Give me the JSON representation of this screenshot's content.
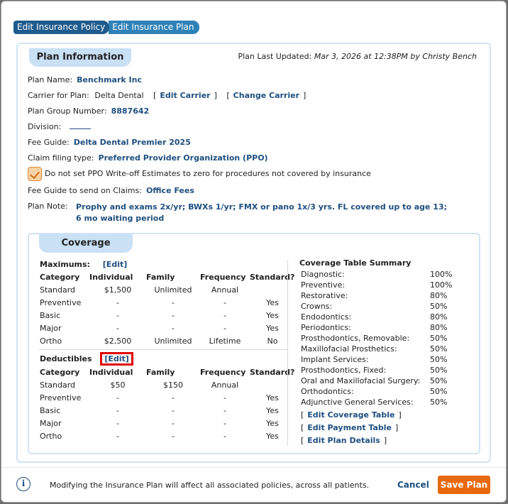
{
  "tabs": [
    "Edit Insurance Policy",
    "Edit Insurance Plan"
  ],
  "plan": {
    "header": "Plan Information",
    "updated_label": "Plan Last Updated:",
    "updated_value": "Mar 3, 2026 at 12:38PM by Christy Bench",
    "name_label": "Plan Name:",
    "name_value": "Benchmark Inc",
    "carrier_label": "Carrier for Plan:",
    "carrier_value": "Delta Dental",
    "edit_carrier": "Edit Carrier",
    "change_carrier": "Change Carrier",
    "group_label": "Plan Group Number:",
    "group_value": "8887642",
    "division_label": "Division:",
    "division_value": "",
    "fee_label": "Fee Guide:",
    "fee_value": "Delta Dental Premier 2025",
    "claim_label": "Claim filing type:",
    "claim_value": "Preferred Provider Organization (PPO)",
    "ppo_checkbox_label": "Do not set PPO Write-off Estimates to zero for procedures not covered by insurance",
    "fee_claims_label": "Fee Guide to send on Claims:",
    "fee_claims_value": "Office Fees",
    "note_label": "Plan Note:",
    "note_line1": "Prophy and exams 2x/yr; BWXs 1/yr; FMX or pano 1x/3 yrs. FL covered up to age 13;",
    "note_line2": "6 mo waiting period"
  },
  "coverage": {
    "header": "Coverage",
    "maximums_label": "Maximums:",
    "deductibles_label": "Deductibles",
    "edit_label": "[Edit]",
    "columns": [
      "Category",
      "Individual",
      "Family",
      "Frequency",
      "Standard?"
    ],
    "maximums": [
      [
        "Standard",
        "$1,500",
        "Unlimited",
        "Annual",
        ""
      ],
      [
        "Preventive",
        "-",
        "-",
        "-",
        "Yes"
      ],
      [
        "Basic",
        "-",
        "-",
        "-",
        "Yes"
      ],
      [
        "Major",
        "-",
        "-",
        "-",
        "Yes"
      ],
      [
        "Ortho",
        "$2,500",
        "Unlimited",
        "Lifetime",
        "No"
      ]
    ],
    "deductibles": [
      [
        "Standard",
        "$50",
        "$150",
        "Annual",
        ""
      ],
      [
        "Preventive",
        "-",
        "-",
        "-",
        "Yes"
      ],
      [
        "Basic",
        "-",
        "-",
        "-",
        "Yes"
      ],
      [
        "Major",
        "-",
        "-",
        "-",
        "Yes"
      ],
      [
        "Ortho",
        "-",
        "-",
        "-",
        "Yes"
      ]
    ],
    "summary_title": "Coverage Table Summary",
    "summary": [
      [
        "Diagnostic:",
        "100%"
      ],
      [
        "Preventive:",
        "100%"
      ],
      [
        "Restorative:",
        "80%"
      ],
      [
        "Crowns:",
        "50%"
      ],
      [
        "Endodontics:",
        "80%"
      ],
      [
        "Periodontics:",
        "80%"
      ],
      [
        "Prosthodontics, Removable:",
        "50%"
      ],
      [
        "Maxillofacial Prosthetics:",
        "50%"
      ],
      [
        "Implant Services:",
        "50%"
      ],
      [
        "Prosthodontics, Fixed:",
        "50%"
      ],
      [
        "Oral and Maxillofacial Surgery:",
        "50%"
      ],
      [
        "Orthodontics:",
        "50%"
      ],
      [
        "Adjunctive General Services:",
        "50%"
      ]
    ],
    "links": [
      "Edit Coverage Table",
      "Edit Payment Table",
      "Edit Plan Details"
    ]
  },
  "footer": {
    "message": "Modifying the Insurance Plan will affect all associated policies, across all patients.",
    "cancel": "Cancel",
    "save": "Save Plan"
  },
  "colors": {
    "primary": "#1f5b8d",
    "accent": "#e8690f",
    "highlight": "#e00000"
  }
}
